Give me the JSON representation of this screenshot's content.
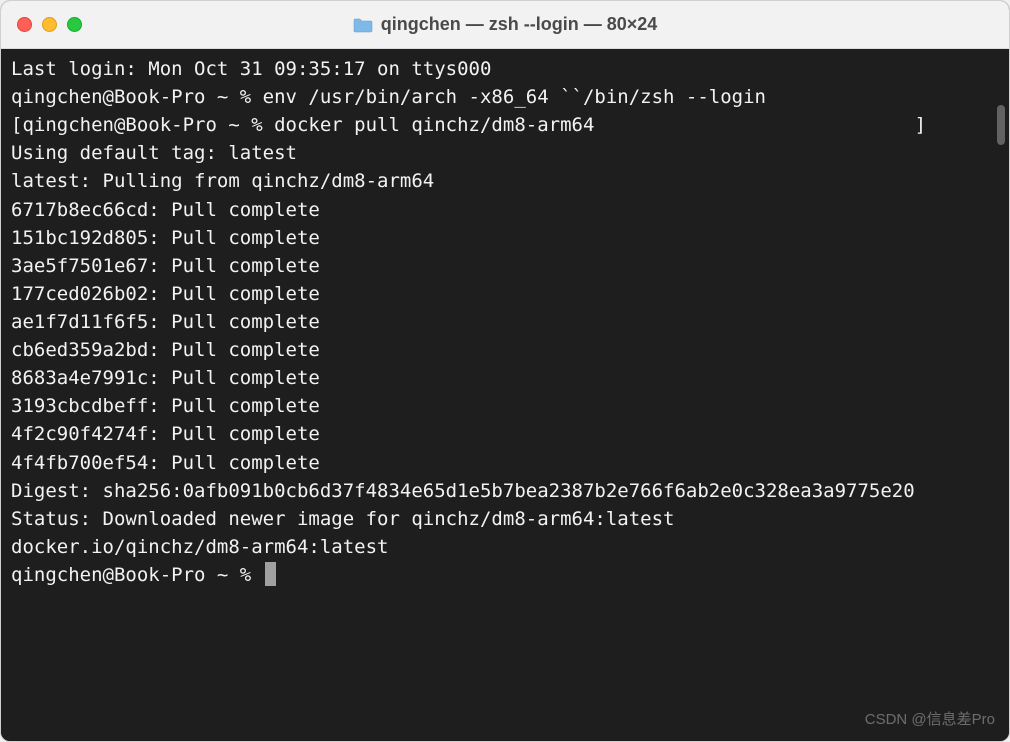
{
  "titlebar": {
    "title": "qingchen — zsh --login — 80×24"
  },
  "terminal": {
    "lines": [
      "Last login: Mon Oct 31 09:35:17 on ttys000",
      "qingchen@Book-Pro ~ % env /usr/bin/arch -x86_64 ``/bin/zsh --login",
      "[qingchen@Book-Pro ~ % docker pull qinchz/dm8-arm64                            ]",
      "Using default tag: latest",
      "latest: Pulling from qinchz/dm8-arm64",
      "6717b8ec66cd: Pull complete",
      "151bc192d805: Pull complete",
      "3ae5f7501e67: Pull complete",
      "177ced026b02: Pull complete",
      "ae1f7d11f6f5: Pull complete",
      "cb6ed359a2bd: Pull complete",
      "8683a4e7991c: Pull complete",
      "3193cbcdbeff: Pull complete",
      "4f2c90f4274f: Pull complete",
      "4f4fb700ef54: Pull complete",
      "Digest: sha256:0afb091b0cb6d37f4834e65d1e5b7bea2387b2e766f6ab2e0c328ea3a9775e20",
      "Status: Downloaded newer image for qinchz/dm8-arm64:latest",
      "docker.io/qinchz/dm8-arm64:latest"
    ],
    "prompt": "qingchen@Book-Pro ~ % "
  },
  "watermark": "CSDN @信息差Pro"
}
